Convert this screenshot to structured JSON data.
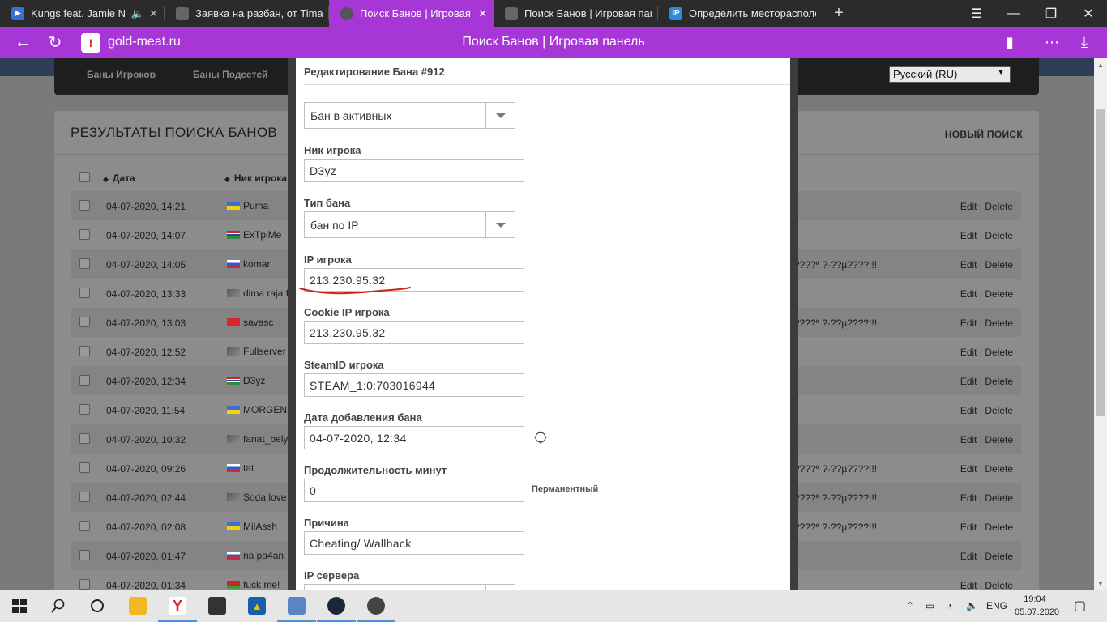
{
  "tabs": [
    {
      "title": "Kungs feat. Jamie N C",
      "icon_color": "#3b6fd1",
      "icon": "play-icon"
    },
    {
      "title": "Заявка на разбан, от Tima",
      "icon_color": "#666666",
      "icon": "steam-game-icon"
    },
    {
      "title": "Поиск Банов | Игровая",
      "icon_color": "#555555",
      "icon": "globe-icon"
    },
    {
      "title": "Поиск Банов | Игровая пан",
      "icon_color": "#666666",
      "icon": "steam-game-icon"
    },
    {
      "title": "Определить месторасполо",
      "icon_color": "#2d8ae0",
      "icon": "ip-icon",
      "icon_text": "IP"
    }
  ],
  "address": {
    "domain": "gold-meat.ru",
    "page_title": "Поиск Банов | Игровая панель"
  },
  "site_nav": {
    "items": [
      "Баны Игроков",
      "Баны Подсетей"
    ],
    "language": "Русский (RU)"
  },
  "bans": {
    "title": "РЕЗУЛЬТАТЫ ПОИСКА БАНОВ",
    "new_search": "НОВЫЙ ПОИСК",
    "columns": {
      "date": "Дата",
      "nick": "Ник игрока"
    },
    "action_edit": "Edit",
    "action_sep": "|",
    "action_delete": "Delete",
    "rows": [
      {
        "date": "04-07-2020, 14:21",
        "nick": "Puma",
        "flag": "ua",
        "reason": ""
      },
      {
        "date": "04-07-2020, 14:07",
        "nick": "ExTpiMe",
        "flag": "gm",
        "reason": ""
      },
      {
        "date": "04-07-2020, 14:05",
        "nick": "komar",
        "flag": "ru",
        "reason": "????º ?·??µ????!!!"
      },
      {
        "date": "04-07-2020, 13:33",
        "nick": "dima raja fr",
        "flag": "none",
        "reason": ""
      },
      {
        "date": "04-07-2020, 13:03",
        "nick": "savasc",
        "flag": "tr",
        "reason": "????º ?·??µ????!!!"
      },
      {
        "date": "04-07-2020, 12:52",
        "nick": "Fullserver",
        "flag": "none",
        "reason": ""
      },
      {
        "date": "04-07-2020, 12:34",
        "nick": "D3yz",
        "flag": "gm",
        "reason": ""
      },
      {
        "date": "04-07-2020, 11:54",
        "nick": "MORGENSH",
        "flag": "ua",
        "reason": ""
      },
      {
        "date": "04-07-2020, 10:32",
        "nick": "fanat_belya",
        "flag": "none",
        "reason": ""
      },
      {
        "date": "04-07-2020, 09:26",
        "nick": "tat",
        "flag": "ru",
        "reason": "????º ?·??µ????!!!"
      },
      {
        "date": "04-07-2020, 02:44",
        "nick": "Soda love n",
        "flag": "none",
        "reason": "????º ?·??µ????!!!"
      },
      {
        "date": "04-07-2020, 02:08",
        "nick": "MilAssh",
        "flag": "ua",
        "reason": "????º ?·??µ????!!!"
      },
      {
        "date": "04-07-2020, 01:47",
        "nick": "na pa4an",
        "flag": "ru",
        "reason": ""
      },
      {
        "date": "04-07-2020, 01:34",
        "nick": "fuck me!",
        "flag": "by",
        "reason": ""
      }
    ]
  },
  "modal": {
    "title": "Редактирование Бана #912",
    "status_select": "Бан в активных",
    "fields": {
      "nick_label": "Ник игрока",
      "nick_value": "D3yz",
      "type_label": "Тип бана",
      "type_value": "бан по IP",
      "ip_label": "IP игрока",
      "ip_value": "213.230.95.32",
      "cookie_ip_label": "Cookie IP игрока",
      "cookie_ip_value": "213.230.95.32",
      "steamid_label": "SteamID игрока",
      "steamid_value": "STEAM_1:0:703016944",
      "date_label": "Дата добавления бана",
      "date_value": "04-07-2020, 12:34",
      "duration_label": "Продолжительность минут",
      "duration_value": "0",
      "permanent_label": "Перманентный",
      "reason_label": "Причина",
      "reason_value": "Cheating/ Wallhack",
      "server_ip_label": "IP сервера"
    }
  },
  "taskbar": {
    "language": "ENG",
    "time": "19:04",
    "date": "05.07.2020"
  },
  "colors": {
    "browser_accent": "#a637d6",
    "annotation_red": "#d0211c"
  }
}
